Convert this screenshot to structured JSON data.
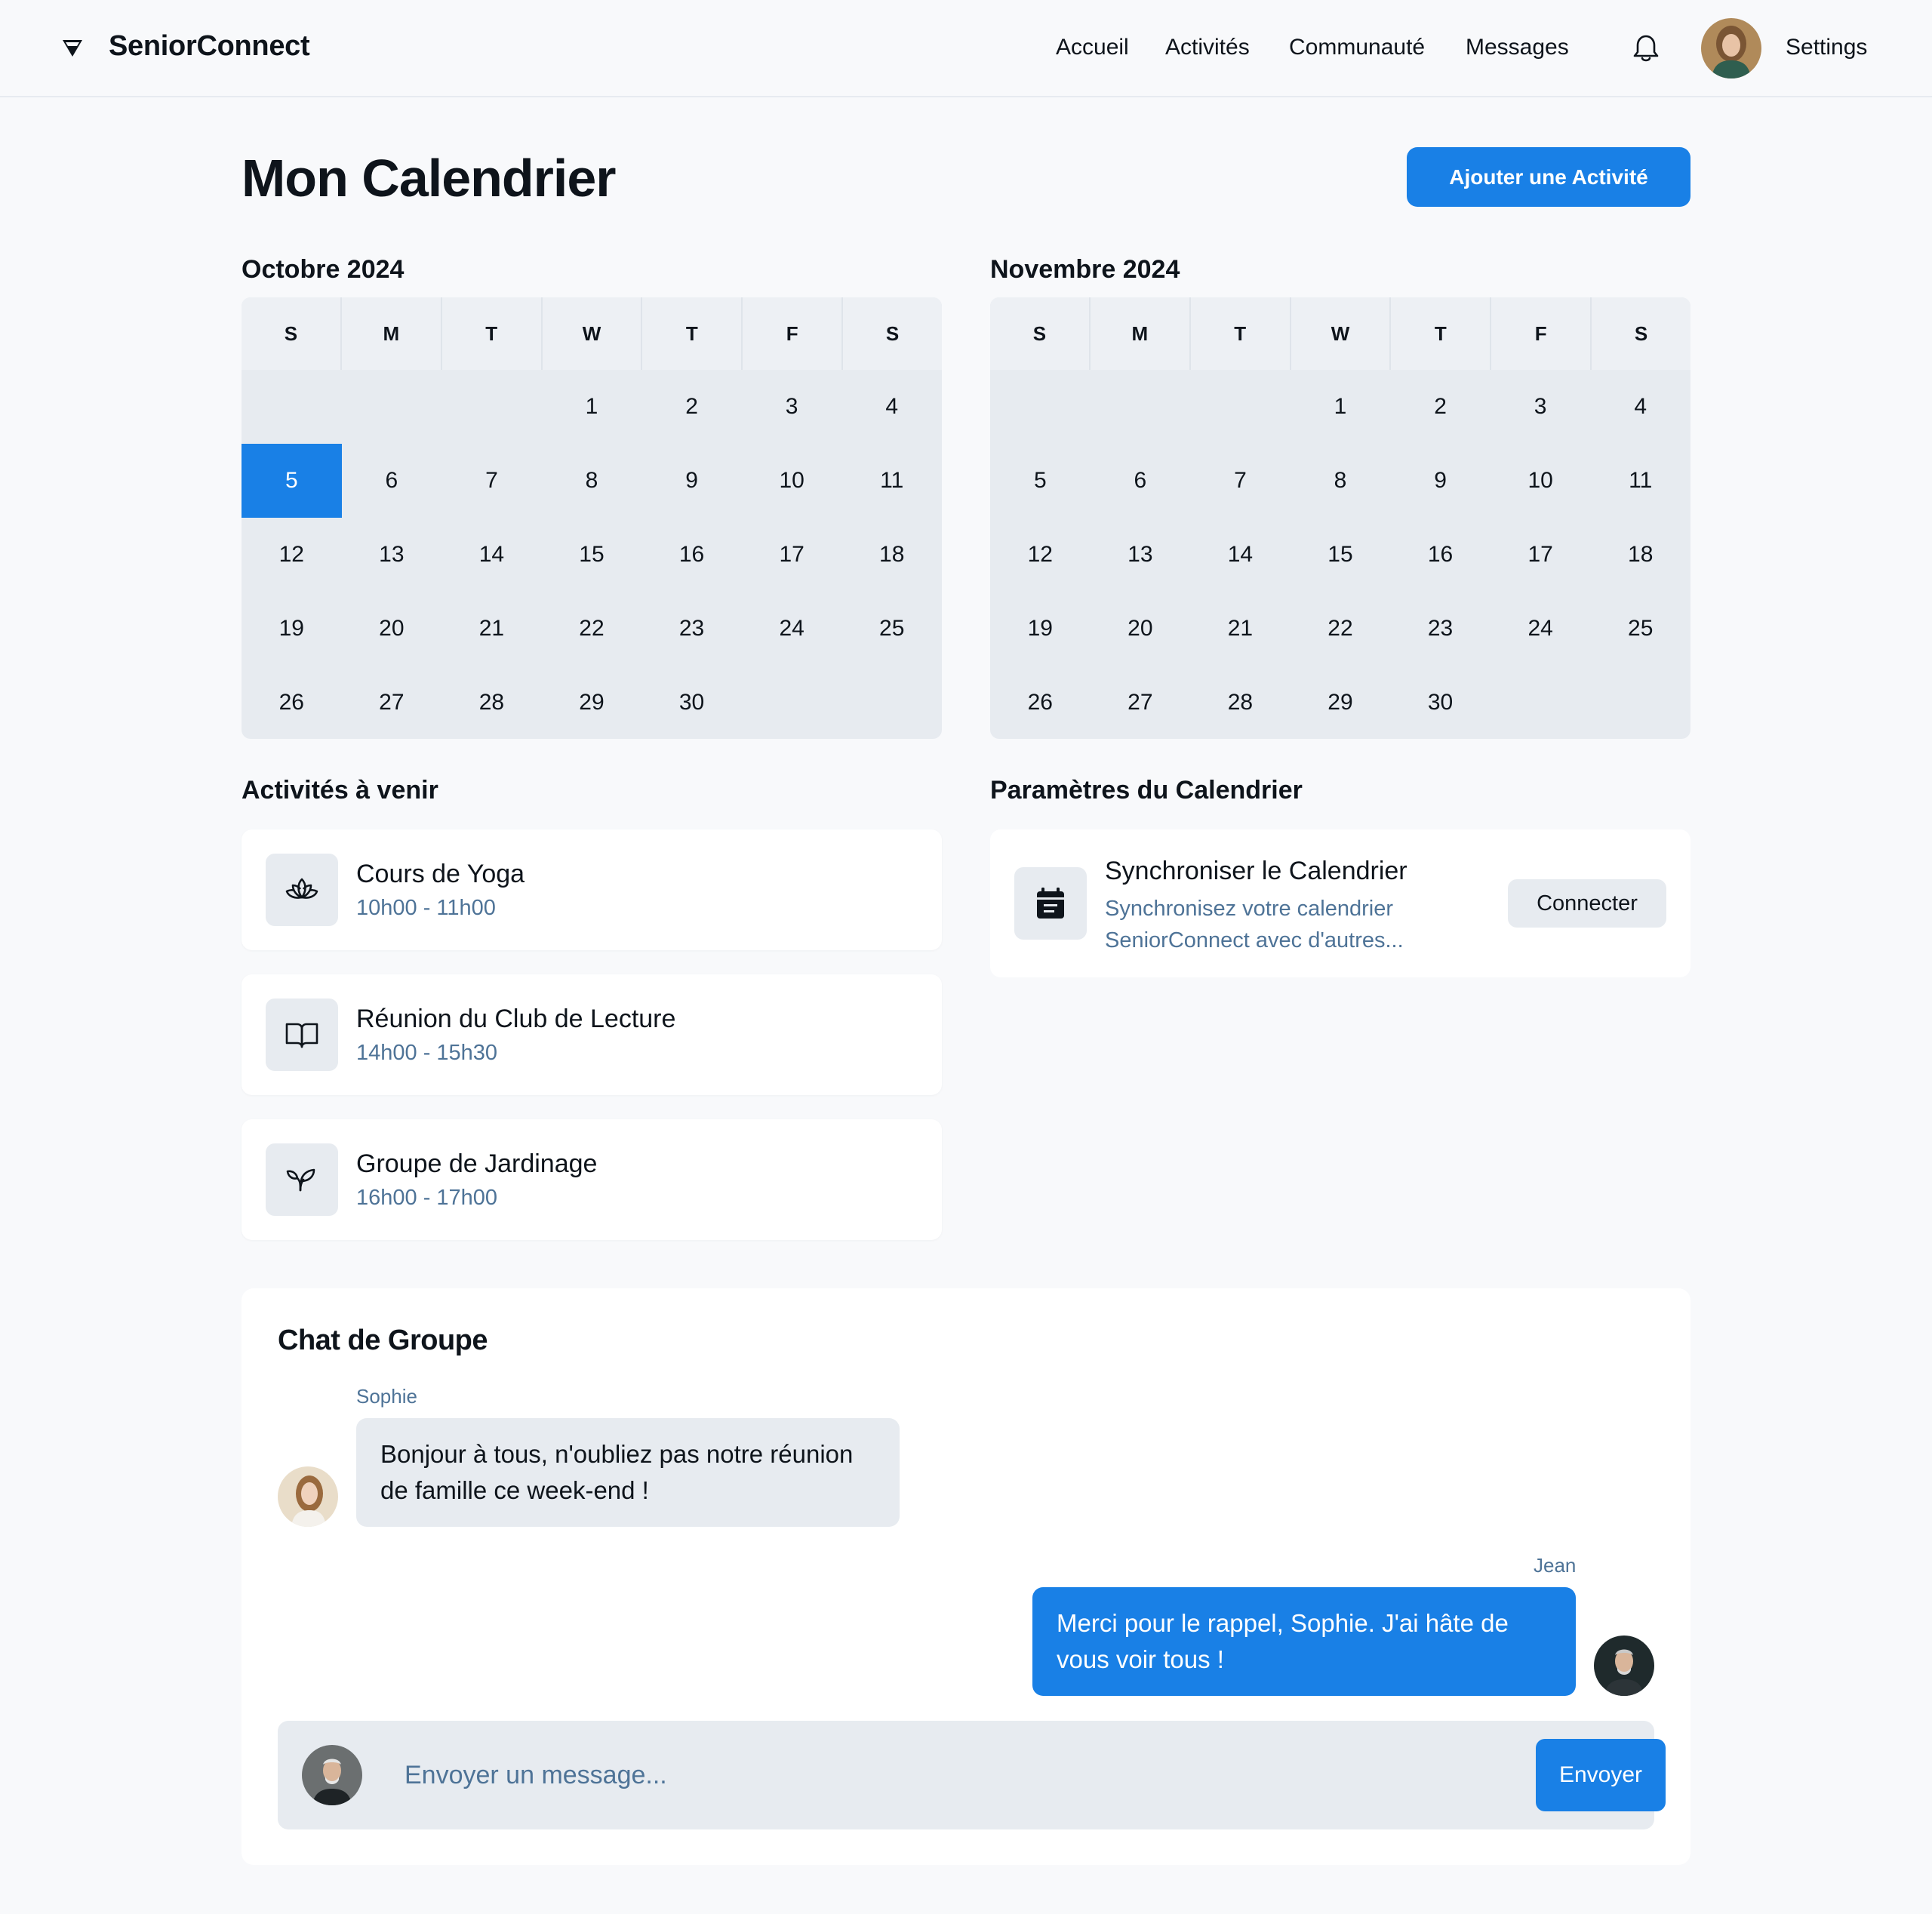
{
  "header": {
    "app_name": "SeniorConnect",
    "nav": [
      "Accueil",
      "Activités",
      "Communauté",
      "Messages"
    ],
    "settings_label": "Settings"
  },
  "page": {
    "title": "Mon Calendrier",
    "add_button": "Ajouter une Activité"
  },
  "calendars": [
    {
      "month": "Octobre 2024",
      "weekdays": [
        "S",
        "M",
        "T",
        "W",
        "T",
        "F",
        "S"
      ],
      "leading_blanks": 3,
      "days": 30,
      "selected_day": 5
    },
    {
      "month": "Novembre 2024",
      "weekdays": [
        "S",
        "M",
        "T",
        "W",
        "T",
        "F",
        "S"
      ],
      "leading_blanks": 3,
      "days": 30,
      "selected_day": null
    }
  ],
  "activities": {
    "title": "Activités à venir",
    "items": [
      {
        "name": "Cours de Yoga",
        "time": "10h00 - 11h00",
        "icon": "lotus-icon"
      },
      {
        "name": "Réunion du Club de Lecture",
        "time": "14h00 - 15h30",
        "icon": "book-icon"
      },
      {
        "name": "Groupe de Jardinage",
        "time": "16h00 - 17h00",
        "icon": "plant-icon"
      }
    ]
  },
  "settings_panel": {
    "title": "Paramètres du Calendrier",
    "sync_title": "Synchroniser le Calendrier",
    "sync_desc_line1": "Synchronisez votre calendrier",
    "sync_desc_line2": "SeniorConnect avec d'autres...",
    "connect_button": "Connecter"
  },
  "chat": {
    "title": "Chat de Groupe",
    "messages": [
      {
        "author": "Sophie",
        "line1": "Bonjour à tous, n'oubliez pas notre réunion",
        "line2": "de famille ce week-end !"
      },
      {
        "author": "Jean",
        "line1": "Merci pour le rappel, Sophie. J'ai hâte de",
        "line2": "vous voir tous !"
      }
    ],
    "input_placeholder": "Envoyer un message...",
    "send_button": "Envoyer"
  },
  "colors": {
    "accent": "#1980e6",
    "muted_text": "#4e7397",
    "surface": "#e7ebf0",
    "background": "#f8f9fb"
  }
}
